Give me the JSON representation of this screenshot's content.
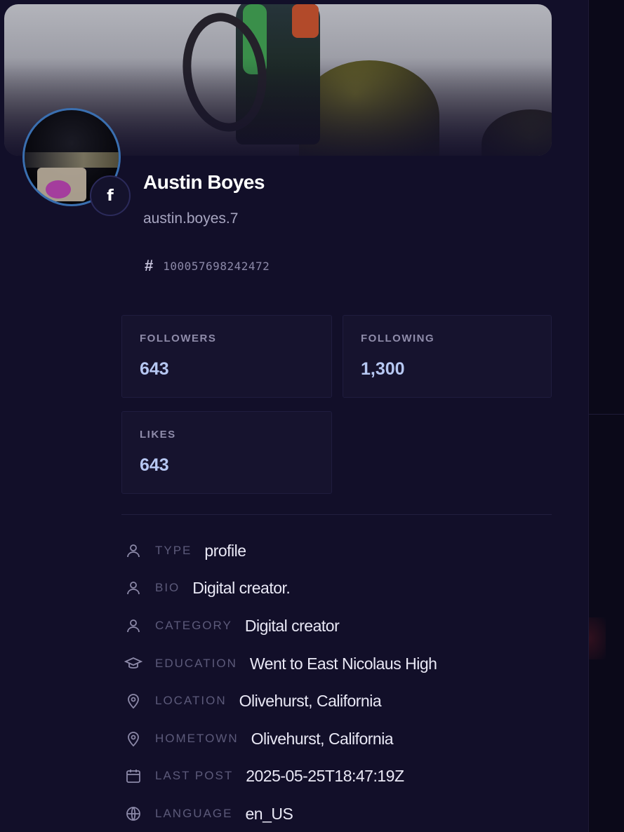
{
  "profile": {
    "name": "Austin Boyes",
    "username": "austin.boyes.7",
    "id_symbol": "#",
    "id": "100057698242472",
    "platform_badge": "f",
    "platform_icon": "facebook-icon"
  },
  "stats": [
    {
      "label": "FOLLOWERS",
      "value": "643"
    },
    {
      "label": "FOLLOWING",
      "value": "1,300"
    },
    {
      "label": "LIKES",
      "value": "643"
    }
  ],
  "info": [
    {
      "key": "TYPE",
      "value": "profile",
      "icon": "user-icon"
    },
    {
      "key": "BIO",
      "value": "Digital creator.",
      "icon": "user-icon"
    },
    {
      "key": "CATEGORY",
      "value": "Digital creator",
      "icon": "user-icon"
    },
    {
      "key": "EDUCATION",
      "value": "Went to East Nicolaus High",
      "icon": "graduation-cap-icon"
    },
    {
      "key": "LOCATION",
      "value": "Olivehurst, California",
      "icon": "map-pin-icon"
    },
    {
      "key": "HOMETOWN",
      "value": "Olivehurst, California",
      "icon": "map-pin-icon"
    },
    {
      "key": "LAST POST",
      "value": "2025-05-25T18:47:19Z",
      "icon": "calendar-icon"
    },
    {
      "key": "LANGUAGE",
      "value": "en_US",
      "icon": "globe-icon"
    }
  ],
  "colors": {
    "background": "#120f29",
    "stat_value": "#b6c7f2",
    "avatar_ring": "#3a6fb0"
  }
}
